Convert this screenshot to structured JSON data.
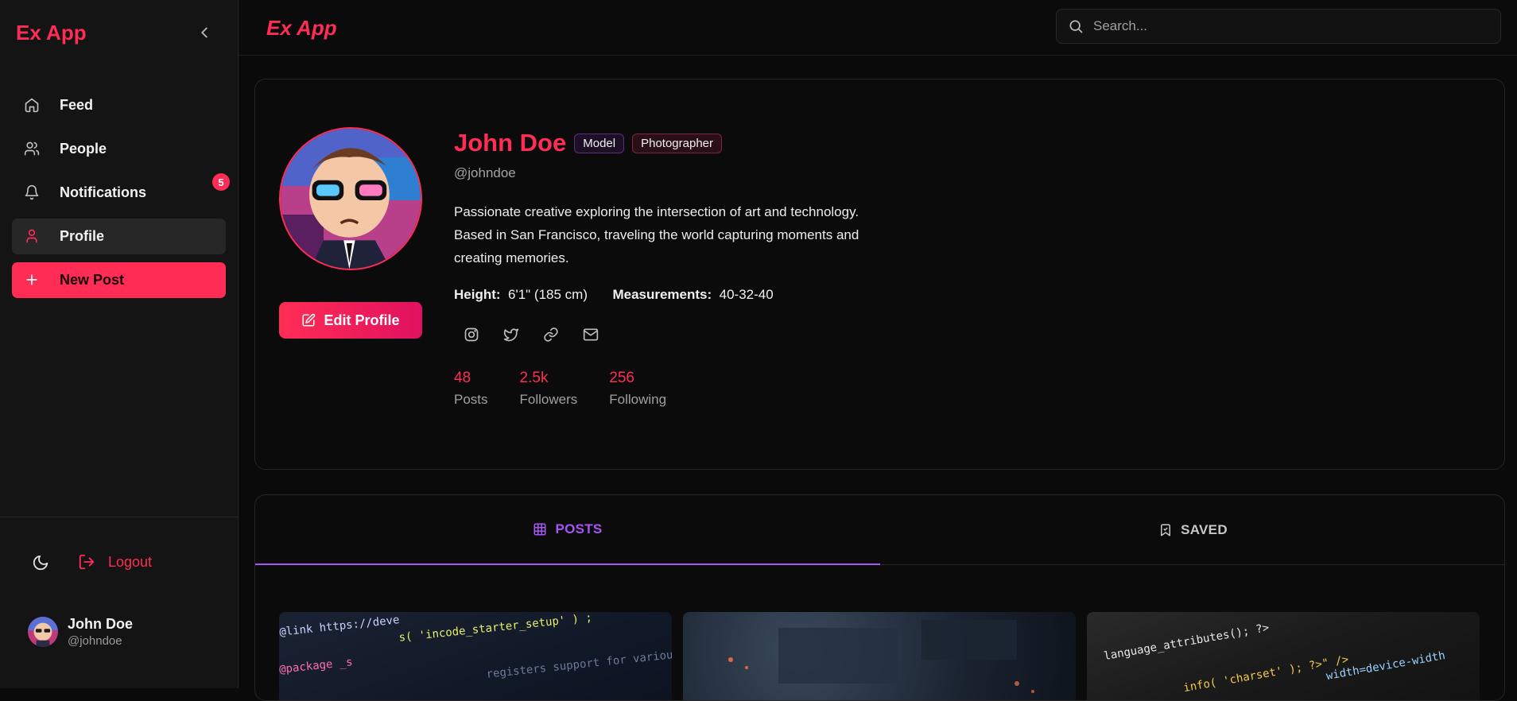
{
  "app": {
    "brand": "Ex App",
    "top_title": "Ex App"
  },
  "search": {
    "placeholder": "Search..."
  },
  "sidebar": {
    "items": [
      {
        "label": "Feed"
      },
      {
        "label": "People"
      },
      {
        "label": "Notifications",
        "badge": "5"
      },
      {
        "label": "Profile"
      },
      {
        "label": "New Post"
      }
    ],
    "logout_label": "Logout",
    "user": {
      "name": "John Doe",
      "handle": "@johndoe"
    }
  },
  "profile": {
    "name": "John Doe",
    "tags": [
      "Model",
      "Photographer"
    ],
    "handle": "@johndoe",
    "bio": "Passionate creative exploring the intersection of art and technology. Based in San Francisco, traveling the world capturing moments and creating memories.",
    "height_label": "Height:",
    "height_value": "6'1\" (185 cm)",
    "measurements_label": "Measurements:",
    "measurements_value": "40-32-40",
    "edit_label": "Edit Profile",
    "counts": [
      {
        "value": "48",
        "label": "Posts"
      },
      {
        "value": "2.5k",
        "label": "Followers"
      },
      {
        "value": "256",
        "label": "Following"
      }
    ]
  },
  "tabs": {
    "posts": "POSTS",
    "saved": "SAVED"
  },
  "thumbs": {
    "code1": {
      "line1": "@link https://deve",
      "line2": "s( 'incode_starter_setup' ) ;",
      "line3": "@package _s",
      "line4": "registers support for various"
    },
    "code3": {
      "line1": "language_attributes(); ?>",
      "line2": "info( 'charset' ); ?>\" />",
      "line3": "width=device-width"
    }
  },
  "colors": {
    "accent": "#ff2d55",
    "tab_accent": "#a855f7"
  }
}
